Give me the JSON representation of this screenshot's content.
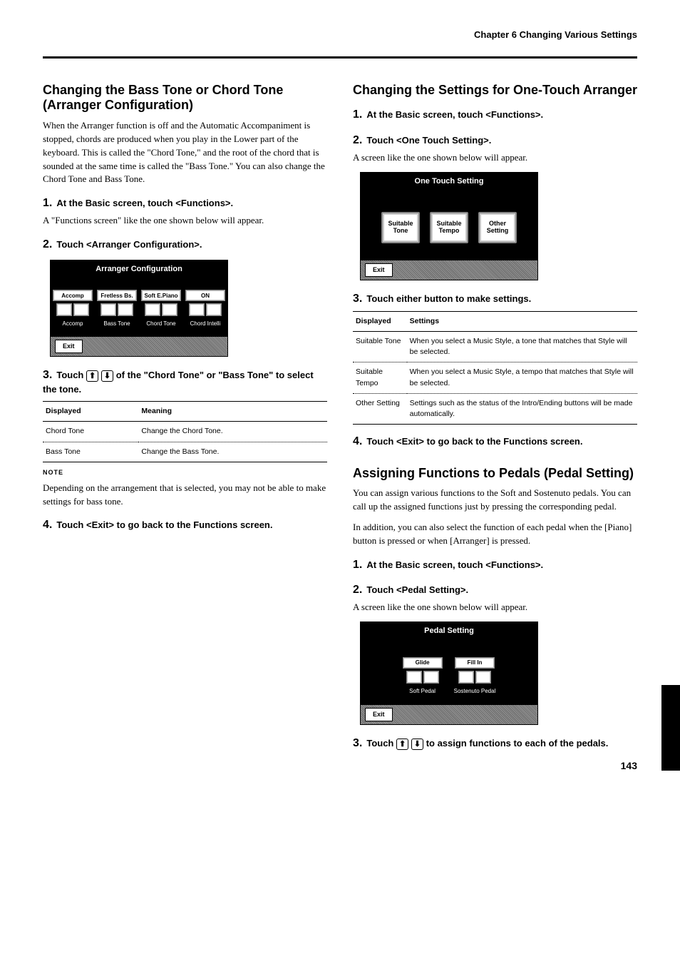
{
  "chapter_header": "Chapter 6 Changing Various Settings",
  "page_number": "143",
  "left": {
    "sec1_title": "Changing the Bass Tone or Chord Tone (Arranger Configuration)",
    "sec1_body1": "When the Arranger function is off and the Automatic Accompaniment is stopped, chords are produced when you play in the Lower part of the keyboard. This is called the \"Chord Tone,\" and the root of the chord that is sounded at the same time is called the \"Bass Tone.\" You can also change the Chord Tone and Bass Tone.",
    "step1": "At the Basic screen, touch <Functions>.",
    "step1_body": "A \"Functions screen\" like the one shown below will appear.",
    "step2": "Touch <Arranger Configuration>.",
    "lcd_arranger": {
      "title": "Arranger Configuration",
      "cols": [
        {
          "value": "Accomp",
          "label": "Accomp"
        },
        {
          "value": "Fretless Bs.",
          "label": "Bass Tone"
        },
        {
          "value": "Soft E.Piano",
          "label": "Chord Tone"
        },
        {
          "value": "ON",
          "label": "Chord Intelli"
        }
      ],
      "exit": "Exit"
    },
    "step3_a": "Touch",
    "step3_b": "of the \"Chord Tone\" or \"Bass Tone\" to select the tone.",
    "table": {
      "h1": "Displayed",
      "h2": "Meaning",
      "r1c1": "Chord Tone",
      "r1c2": "Change the Chord Tone.",
      "r2c1": "Bass Tone",
      "r2c2": "Change the Bass Tone."
    },
    "note": "Depending on the arrangement that is selected, you may not be able to make settings for bass tone.",
    "step4": "Touch <Exit> to go back to the Functions screen."
  },
  "right": {
    "sec2_title": "Changing the Settings for One-Touch Arranger",
    "step1": "At the Basic screen, touch <Functions>.",
    "step2": "Touch <One Touch Setting>.",
    "step2_body": "A screen like the one shown below will appear.",
    "lcd_ots": {
      "title": "One Touch Setting",
      "btn1a": "Suitable",
      "btn1b": "Tone",
      "btn2a": "Suitable",
      "btn2b": "Tempo",
      "btn3a": "Other",
      "btn3b": "Setting",
      "exit": "Exit"
    },
    "step3": "Touch either button to make settings.",
    "table": {
      "h1": "Displayed",
      "h2": "Settings",
      "r1c1": "Suitable Tone",
      "r1c2": "When you select a Music Style, a tone that matches that Style will be selected.",
      "r2c1": "Suitable Tempo",
      "r2c2": "When you select a Music Style, a tempo that matches that Style will be selected.",
      "r3c1": "Other Setting",
      "r3c2": "Settings such as the status of the Intro/Ending buttons will be made automatically."
    },
    "step4": "Touch <Exit> to go back to the Functions screen.",
    "sec3_title": "Assigning Functions to Pedals (Pedal Setting)",
    "sec3_body1": "You can assign various functions to the Soft and Sostenuto pedals. You can call up the assigned functions just by pressing the corresponding pedal.",
    "sec3_body2": "In addition, you can also select the function of each pedal when the [Piano] button is pressed or when [Arranger] is pressed.",
    "step_s1": "At the Basic screen, touch <Functions>.",
    "step_s2": "Touch <Pedal Setting>.",
    "step_s2_body": "A screen like the one shown below will appear.",
    "lcd_pedal": {
      "title": "Pedal Setting",
      "cols": [
        {
          "value": "Glide",
          "label": "Soft Pedal"
        },
        {
          "value": "Fill In",
          "label": "Sostenuto Pedal"
        }
      ],
      "exit": "Exit"
    },
    "step_s3_a": "Touch",
    "step_s3_b": "to assign functions to each of the pedals."
  },
  "note_label": "NOTE"
}
